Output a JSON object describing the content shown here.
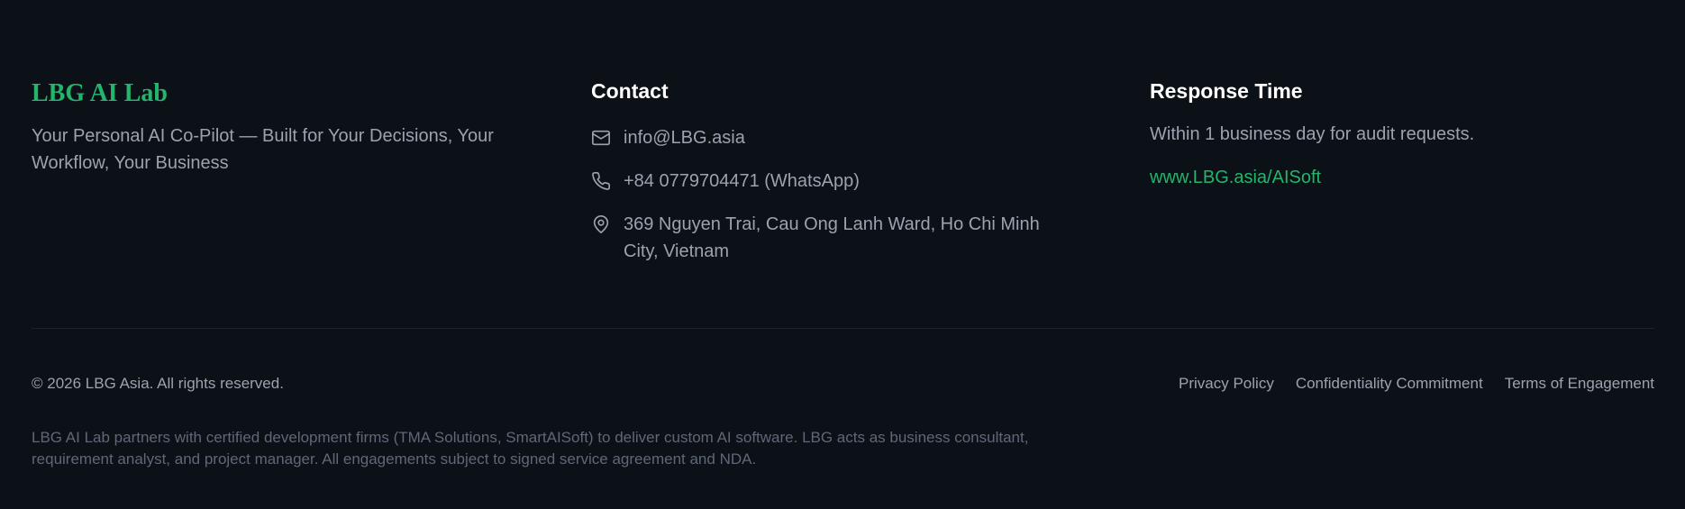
{
  "brand": {
    "name": "LBG AI Lab",
    "tagline": "Your Personal AI Co-Pilot — Built for Your Decisions, Your Workflow, Your Business"
  },
  "contact": {
    "title": "Contact",
    "items": [
      {
        "icon": "mail-icon",
        "text": "info@LBG.asia"
      },
      {
        "icon": "phone-icon",
        "text": "+84 0779704471 (WhatsApp)"
      },
      {
        "icon": "map-pin-icon",
        "text": "369 Nguyen Trai, Cau Ong Lanh Ward, Ho Chi Minh City, Vietnam"
      }
    ]
  },
  "response": {
    "title": "Response Time",
    "text": "Within 1 business day for audit requests.",
    "link": "www.LBG.asia/AISoft"
  },
  "bottom": {
    "copyright": "© 2026 LBG Asia. All rights reserved.",
    "links": [
      "Privacy Policy",
      "Confidentiality Commitment",
      "Terms of Engagement"
    ],
    "disclaimer": "LBG AI Lab partners with certified development firms (TMA Solutions, SmartAISoft) to deliver custom AI software. LBG acts as business consultant, requirement analyst, and project manager. All engagements subject to signed service agreement and NDA."
  },
  "colors": {
    "background": "#0c1017",
    "accent": "#22b56b",
    "text": "#9ba3af",
    "muted": "#5f6876",
    "heading": "#ffffff"
  }
}
